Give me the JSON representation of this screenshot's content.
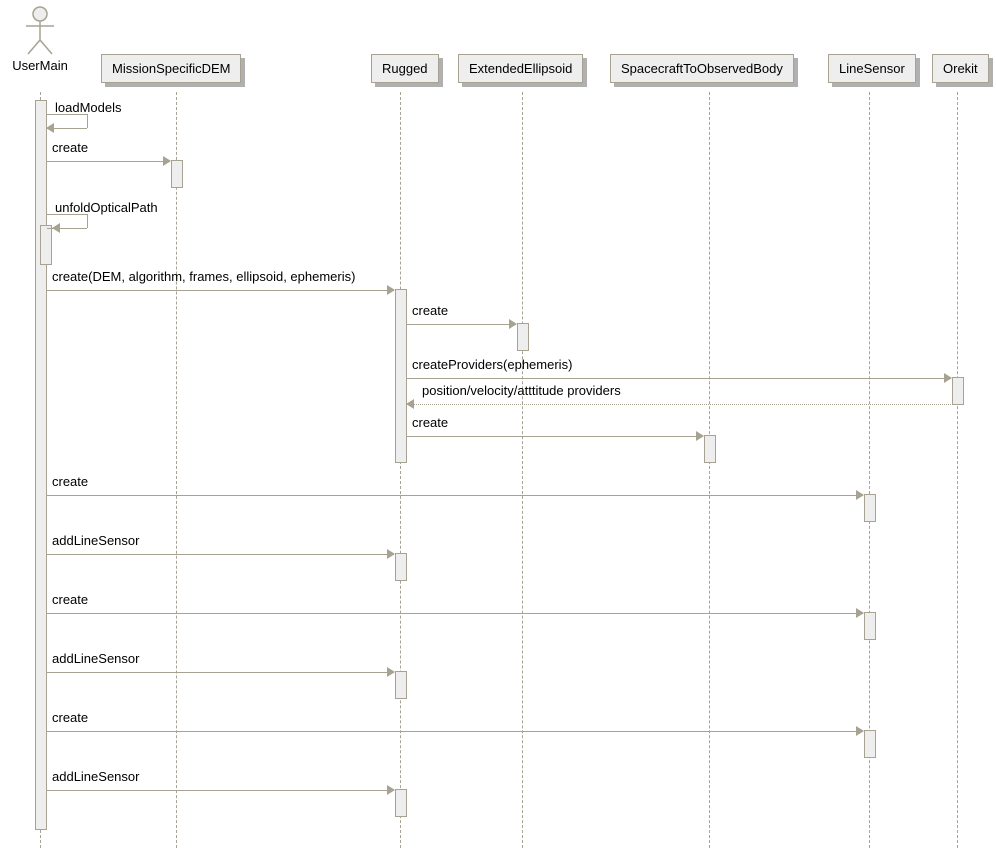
{
  "participants": {
    "usermain": "UserMain",
    "mission_specific_dem": "MissionSpecificDEM",
    "rugged": "Rugged",
    "extended_ellipsoid": "ExtendedEllipsoid",
    "spacecraft_to_observed_body": "SpacecraftToObservedBody",
    "line_sensor": "LineSensor",
    "orekit": "Orekit"
  },
  "messages": {
    "m1": "loadModels",
    "m2": "create",
    "m3": "unfoldOpticalPath",
    "m4": "create(DEM, algorithm, frames, ellipsoid, ephemeris)",
    "m5": "create",
    "m6": "createProviders(ephemeris)",
    "m7": "position/velocity/atttitude providers",
    "m8": "create",
    "m9": "create",
    "m10": "addLineSensor",
    "m11": "create",
    "m12": "addLineSensor",
    "m13": "create",
    "m14": "addLineSensor"
  },
  "chart_data": {
    "type": "sequence_diagram",
    "actors": [
      "UserMain"
    ],
    "participants": [
      "MissionSpecificDEM",
      "Rugged",
      "ExtendedEllipsoid",
      "SpacecraftToObservedBody",
      "LineSensor",
      "Orekit"
    ],
    "interactions": [
      {
        "from": "UserMain",
        "to": "UserMain",
        "label": "loadModels",
        "type": "self"
      },
      {
        "from": "UserMain",
        "to": "MissionSpecificDEM",
        "label": "create",
        "type": "sync"
      },
      {
        "from": "UserMain",
        "to": "UserMain",
        "label": "unfoldOpticalPath",
        "type": "self"
      },
      {
        "from": "UserMain",
        "to": "Rugged",
        "label": "create(DEM, algorithm, frames, ellipsoid, ephemeris)",
        "type": "sync"
      },
      {
        "from": "Rugged",
        "to": "ExtendedEllipsoid",
        "label": "create",
        "type": "sync"
      },
      {
        "from": "Rugged",
        "to": "Orekit",
        "label": "createProviders(ephemeris)",
        "type": "sync"
      },
      {
        "from": "Orekit",
        "to": "Rugged",
        "label": "position/velocity/atttitude providers",
        "type": "return"
      },
      {
        "from": "Rugged",
        "to": "SpacecraftToObservedBody",
        "label": "create",
        "type": "sync"
      },
      {
        "from": "UserMain",
        "to": "LineSensor",
        "label": "create",
        "type": "sync"
      },
      {
        "from": "UserMain",
        "to": "Rugged",
        "label": "addLineSensor",
        "type": "sync"
      },
      {
        "from": "UserMain",
        "to": "LineSensor",
        "label": "create",
        "type": "sync"
      },
      {
        "from": "UserMain",
        "to": "Rugged",
        "label": "addLineSensor",
        "type": "sync"
      },
      {
        "from": "UserMain",
        "to": "LineSensor",
        "label": "create",
        "type": "sync"
      },
      {
        "from": "UserMain",
        "to": "Rugged",
        "label": "addLineSensor",
        "type": "sync"
      }
    ]
  }
}
